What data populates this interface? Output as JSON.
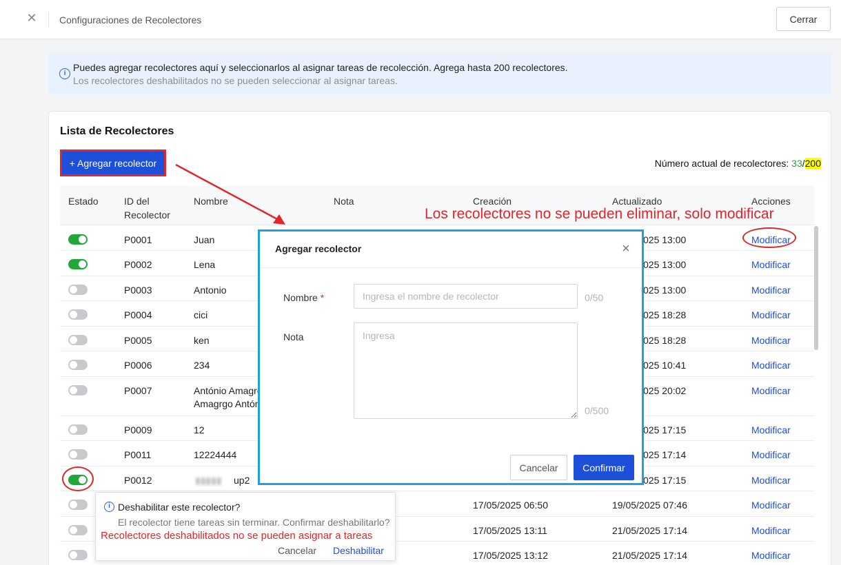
{
  "topbar": {
    "title": "Configuraciones de Recolectores",
    "close_label": "Cerrar"
  },
  "banner": {
    "line1": "Puedes agregar recolectores aquí y seleccionarlos al asignar tareas de recolección. Agrega hasta 200 recolectores.",
    "line2": "Los recolectores deshabilitados no se pueden seleccionar al asignar tareas."
  },
  "list": {
    "title": "Lista de Recolectores",
    "add_label": "+ Agregar recolector",
    "count_label": "Número actual de recolectores: ",
    "count_current": "33",
    "count_sep": "/",
    "count_max": "200"
  },
  "table": {
    "headers": {
      "estado": "Estado",
      "id_line1": "ID del",
      "id_line2": "Recolector",
      "nombre": "Nombre",
      "nota": "Nota",
      "creacion": "Creación",
      "actualizado": "Actualizado",
      "acciones": "Acciones"
    },
    "action_label": "Modificar",
    "rows": [
      {
        "id": "P0001",
        "name": "Juan",
        "updated": "025 13:00",
        "enabled": true
      },
      {
        "id": "P0002",
        "name": "Lena",
        "updated": "025 13:00",
        "enabled": true
      },
      {
        "id": "P0003",
        "name": "Antonio",
        "updated": "025 13:00",
        "enabled": false
      },
      {
        "id": "P0004",
        "name": "cici",
        "updated": "025 18:28",
        "enabled": false
      },
      {
        "id": "P0005",
        "name": "ken",
        "updated": "025 18:28",
        "enabled": false
      },
      {
        "id": "P0006",
        "name": "234",
        "updated": "025 10:41",
        "enabled": false
      },
      {
        "id": "P0007",
        "name": "António Amagrg",
        "name2": "Amagrgo Antón",
        "updated": "025 20:02",
        "enabled": false
      },
      {
        "id": "P0009",
        "name": "12",
        "updated": "025 17:15",
        "enabled": false
      },
      {
        "id": "P0011",
        "name": "12224444",
        "updated": "025 17:14",
        "enabled": false
      },
      {
        "id": "P0012",
        "name": "up2",
        "updated": "025 17:15",
        "enabled": true
      },
      {
        "id": "",
        "name": "",
        "created": "17/05/2025 06:50",
        "updated": "19/05/2025 07:46",
        "enabled": false
      },
      {
        "id": "",
        "name": "",
        "created": "17/05/2025 13:11",
        "updated": "21/05/2025 17:14",
        "enabled": false
      },
      {
        "id": "",
        "name": "",
        "created": "17/05/2025 13:12",
        "updated": "21/05/2025 17:14",
        "enabled": false
      }
    ]
  },
  "annotations": {
    "no_delete": "Los recolectores no se pueden eliminar, solo modificar",
    "disabled_note": "Recolectores deshabilitados no se pueden asignar a tareas"
  },
  "modal": {
    "title": "Agregar recolector",
    "name_label": "Nombre",
    "required_mark": "*",
    "name_placeholder": "Ingresa el nombre de recolector",
    "name_count": "0/50",
    "note_label": "Nota",
    "note_placeholder": "Ingresa",
    "note_count": "0/500",
    "cancel_label": "Cancelar",
    "confirm_label": "Confirmar"
  },
  "popconfirm": {
    "title": "Deshabilitar este recolector?",
    "description": "El recolector tiene tareas sin terminar. Confirmar deshabilitarlo?",
    "cancel_label": "Cancelar",
    "ok_label": "Deshabilitar"
  },
  "colors": {
    "accent": "#1d4fd8",
    "toggle_on": "#22a73a",
    "annotation_red": "#e0262c",
    "modal_border": "#1da1e2"
  }
}
